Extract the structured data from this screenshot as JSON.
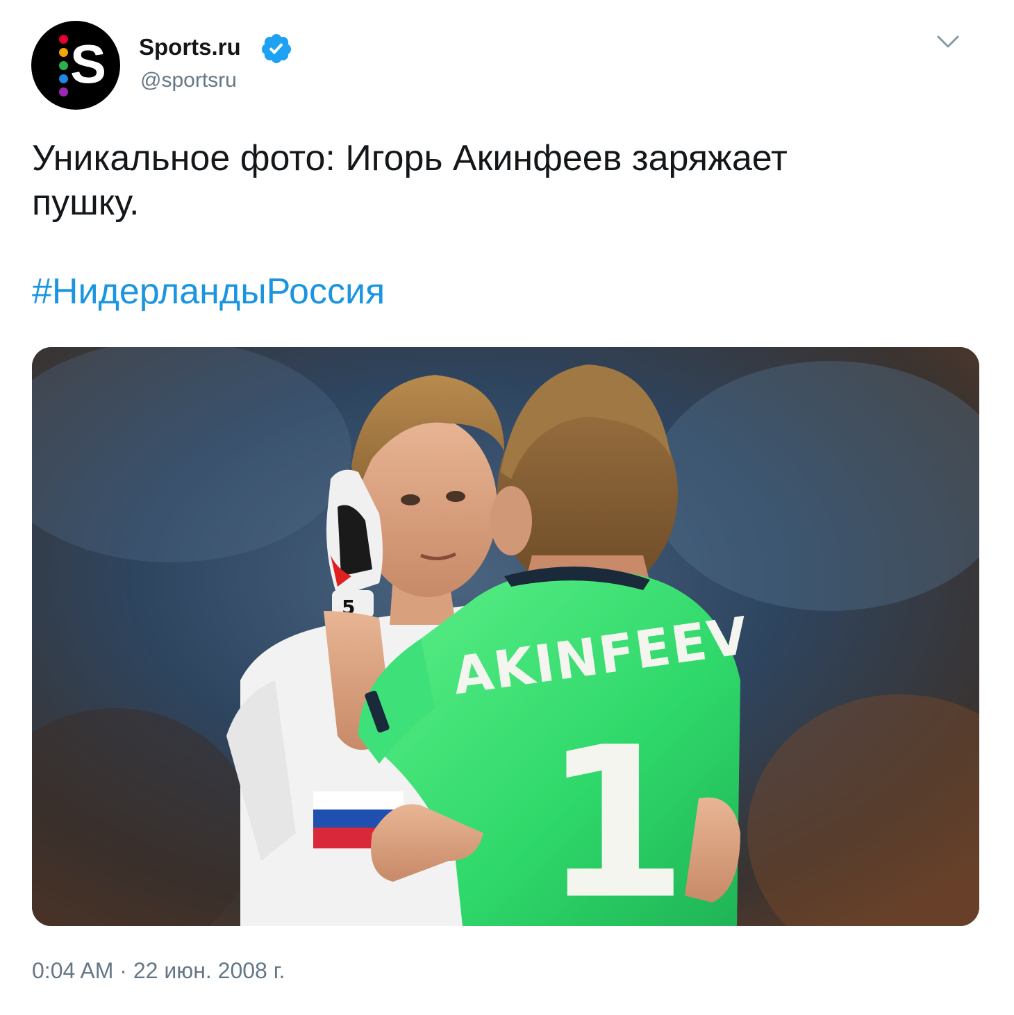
{
  "author": {
    "display_name": "Sports.ru",
    "handle": "@sportsru",
    "verified": true,
    "avatar_letter": "S",
    "avatar_dot_colors": [
      "#e4002b",
      "#f5a300",
      "#2bb24c",
      "#1e88e5",
      "#9c27b0"
    ]
  },
  "tweet": {
    "text": "Уникальное фото: Игорь Акинфеев заряжает\nпушку.",
    "hashtag": "#НидерландыРоссия",
    "timestamp": "0:04 AM · 22 июн. 2008 г."
  },
  "photo": {
    "jersey_name": "AKINFEEV",
    "jersey_number": "1",
    "glove_number": "5"
  },
  "colors": {
    "link": "#1b95e0",
    "text": "#14171a",
    "secondary": "#657786",
    "verified": "#1da1f2"
  }
}
